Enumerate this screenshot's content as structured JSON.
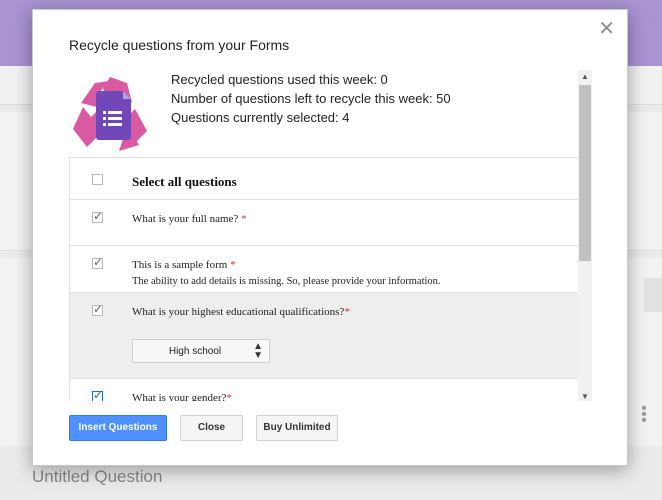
{
  "background": {
    "untitled_question": "Untitled Question",
    "more_icon": "more-vert-icon"
  },
  "dialog": {
    "title": "Recycle questions from your Forms",
    "close_icon": "close-icon",
    "logo_icon": "recycle-forms-logo-icon",
    "stats": {
      "used_this_week": "Recycled questions used this week: 0",
      "left_this_week": "Number of questions left to recycle this week: 50",
      "currently_selected": "Questions currently selected: 4"
    },
    "select_all_label": "Select all questions",
    "questions": [
      {
        "title": "What is your full name?",
        "required_mark": " *",
        "checked": true
      },
      {
        "title": "This is a sample form",
        "required_mark": " *",
        "description": "The ability to add details is missing. So, please provide your information.",
        "checked": true
      },
      {
        "title": "What is your highest educational qualifications?",
        "required_mark": "*",
        "checked": true,
        "select_value": "High school"
      },
      {
        "title": "What is your gender?",
        "required_mark": "*",
        "checked": true
      }
    ],
    "buttons": {
      "insert": "Insert Questions",
      "close": "Close",
      "buy": "Buy Unlimited"
    }
  },
  "colors": {
    "header": "#a993d3",
    "primary_button": "#4d90fe",
    "required": "#d93025",
    "logo_pink": "#d95aa0",
    "logo_purple": "#7248b9"
  }
}
